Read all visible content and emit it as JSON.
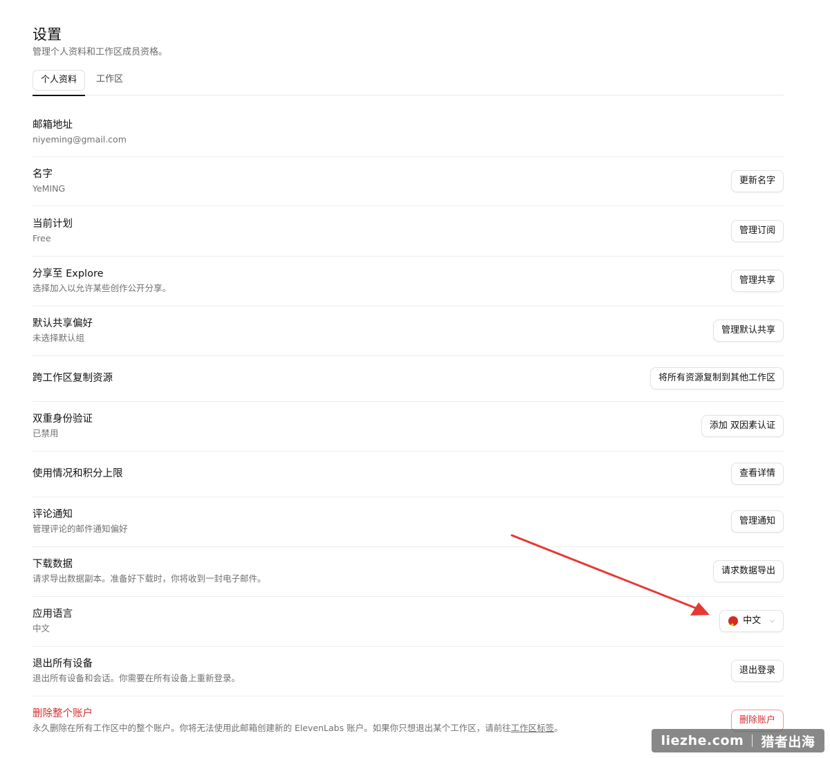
{
  "header": {
    "title": "设置",
    "subtitle": "管理个人资料和工作区成员资格。"
  },
  "tabs": [
    {
      "label": "个人资料",
      "active": true
    },
    {
      "label": "工作区",
      "active": false
    }
  ],
  "rows": {
    "email": {
      "title": "邮箱地址",
      "desc": "niyeming@gmail.com"
    },
    "name": {
      "title": "名字",
      "desc": "YeMING",
      "button": "更新名字"
    },
    "plan": {
      "title": "当前计划",
      "desc": "Free",
      "button": "管理订阅"
    },
    "explore": {
      "title": "分享至 Explore",
      "desc": "选择加入以允许某些创作公开分享。",
      "button": "管理共享"
    },
    "default_share": {
      "title": "默认共享偏好",
      "desc": "未选择默认组",
      "button": "管理默认共享"
    },
    "copy_resources": {
      "title": "跨工作区复制资源",
      "button": "将所有资源复制到其他工作区"
    },
    "two_factor": {
      "title": "双重身份验证",
      "desc": "已禁用",
      "button": "添加 双因素认证"
    },
    "usage": {
      "title": "使用情况和积分上限",
      "button": "查看详情"
    },
    "comments": {
      "title": "评论通知",
      "desc": "管理评论的邮件通知偏好",
      "button": "管理通知"
    },
    "download": {
      "title": "下载数据",
      "desc": "请求导出数据副本。准备好下载时，你将收到一封电子邮件。",
      "button": "请求数据导出"
    },
    "language": {
      "title": "应用语言",
      "desc": "中文",
      "selected": "中文",
      "flag_icon": "china-flag-icon"
    },
    "logout_all": {
      "title": "退出所有设备",
      "desc": "退出所有设备和会话。你需要在所有设备上重新登录。",
      "button": "退出登录"
    },
    "delete": {
      "title": "删除整个账户",
      "desc": "永久删除在所有工作区中的整个账户。你将无法使用此邮箱创建新的 ElevenLabs 账户。如果你只想退出某个工作区，请前往",
      "desc_link": "工作区标签",
      "desc_end": "。",
      "button": "删除账户"
    }
  },
  "watermark": {
    "site": "liezhe.com",
    "brand": "猎者出海"
  },
  "colors": {
    "danger": "#d32f2f",
    "arrow": "#e53935",
    "text": "#111111",
    "muted": "#707070"
  }
}
